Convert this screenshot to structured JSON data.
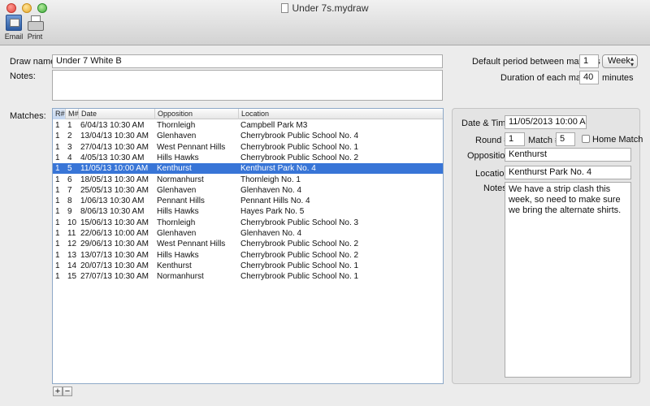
{
  "window": {
    "title": "Under 7s.mydraw"
  },
  "toolbar": {
    "email_label": "Email",
    "print_label": "Print"
  },
  "form": {
    "draw_name_label": "Draw name:",
    "draw_name_value": "Under 7 White B",
    "notes_label": "Notes:",
    "notes_value": "",
    "matches_label": "Matches:",
    "default_period_label": "Default period between matches",
    "default_period_value": "1",
    "default_period_unit": "Week",
    "duration_label": "Duration of each match",
    "duration_value": "40",
    "duration_unit": "minutes"
  },
  "table": {
    "columns": [
      "R#",
      "M#",
      "Date",
      "Opposition",
      "Location"
    ],
    "selected_index": 4,
    "rows": [
      {
        "r": "1",
        "m": "1",
        "date": "6/04/13 10:30 AM",
        "opposition": "Thornleigh",
        "location": "Campbell Park M3"
      },
      {
        "r": "1",
        "m": "2",
        "date": "13/04/13 10:30 AM",
        "opposition": "Glenhaven",
        "location": "Cherrybrook Public School No. 4"
      },
      {
        "r": "1",
        "m": "3",
        "date": "27/04/13 10:30 AM",
        "opposition": "West Pennant Hills",
        "location": "Cherrybrook Public School No. 1"
      },
      {
        "r": "1",
        "m": "4",
        "date": "4/05/13 10:30 AM",
        "opposition": "Hills Hawks",
        "location": "Cherrybrook Public School No. 2"
      },
      {
        "r": "1",
        "m": "5",
        "date": "11/05/13 10:00 AM",
        "opposition": "Kenthurst",
        "location": "Kenthurst Park No. 4"
      },
      {
        "r": "1",
        "m": "6",
        "date": "18/05/13 10:30 AM",
        "opposition": "Normanhurst",
        "location": "Thornleigh No. 1"
      },
      {
        "r": "1",
        "m": "7",
        "date": "25/05/13 10:30 AM",
        "opposition": "Glenhaven",
        "location": "Glenhaven No. 4"
      },
      {
        "r": "1",
        "m": "8",
        "date": "1/06/13 10:30 AM",
        "opposition": "Pennant Hills",
        "location": "Pennant Hills No. 4"
      },
      {
        "r": "1",
        "m": "9",
        "date": "8/06/13 10:30 AM",
        "opposition": "Hills Hawks",
        "location": "Hayes Park No. 5"
      },
      {
        "r": "1",
        "m": "10",
        "date": "15/06/13 10:30 AM",
        "opposition": "Thornleigh",
        "location": "Cherrybrook Public School No. 3"
      },
      {
        "r": "1",
        "m": "11",
        "date": "22/06/13 10:00 AM",
        "opposition": "Glenhaven",
        "location": "Glenhaven No. 4"
      },
      {
        "r": "1",
        "m": "12",
        "date": "29/06/13 10:30 AM",
        "opposition": "West Pennant Hills",
        "location": "Cherrybrook Public School No. 2"
      },
      {
        "r": "1",
        "m": "13",
        "date": "13/07/13 10:30 AM",
        "opposition": "Hills Hawks",
        "location": "Cherrybrook Public School No. 2"
      },
      {
        "r": "1",
        "m": "14",
        "date": "20/07/13 10:30 AM",
        "opposition": "Kenthurst",
        "location": "Cherrybrook Public School No. 1"
      },
      {
        "r": "1",
        "m": "15",
        "date": "27/07/13 10:30 AM",
        "opposition": "Normanhurst",
        "location": "Cherrybrook Public School No. 1"
      }
    ],
    "add_label": "+",
    "remove_label": "−"
  },
  "details": {
    "datetime_label": "Date & Time",
    "datetime_value": "11/05/2013 10:00 AM",
    "round_label": "Round #",
    "round_value": "1",
    "match_label": "Match #",
    "match_value": "5",
    "home_match_label": "Home Match",
    "home_match_checked": false,
    "opposition_label": "Opposition",
    "opposition_value": "Kenthurst",
    "location_label": "Location",
    "location_value": "Kenthurst Park No. 4",
    "notes_label": "Notes",
    "notes_value": "We have a strip clash this week, so need to make sure we bring the alternate shirts."
  }
}
